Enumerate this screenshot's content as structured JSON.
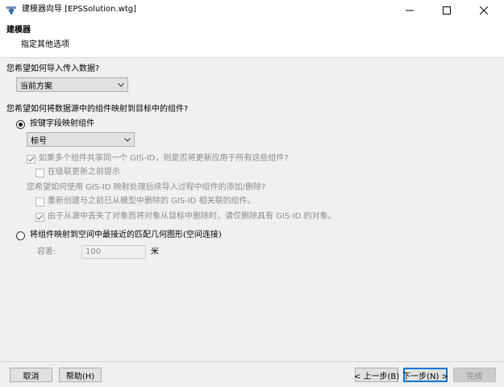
{
  "window": {
    "title": "建模器向导 [EPSSolution.wtg]",
    "app_icon": "modeler-icon",
    "controls": {
      "minimize": "minimize-icon",
      "maximize": "maximize-icon",
      "close": "close-icon"
    }
  },
  "header": {
    "title": "建模器",
    "subtitle": "指定其他选项"
  },
  "import_section": {
    "question": "您希望如何导入传入数据?",
    "combo_value": "当前方案"
  },
  "mapping_section": {
    "question": "您希望如何将数据源中的组件映射到目标中的组件?",
    "radio_key_label": "按键字段映射组件",
    "key_field_value": "标号",
    "share_gisid_label": "如果多个组件共享同一个 GIS-ID，则是否将更新应用于所有这些组件?",
    "cascade_prompt_label": "在级联更新之前提示",
    "gisid_question": "您希望如何使用 GIS-ID 映射处理后续导入过程中组件的添加/删除?",
    "recreate_label": "重新创建与之前已从模型中删除的 GIS-ID 相关联的组件。",
    "delete_missing_label": "由于从源中丢失了对象而将对象从目标中删除时，请仅删除具有 GIS-ID 的对象。",
    "radio_spatial_label": "将组件映射到空间中最接近的匹配几何图形(空间连接)",
    "tolerance_label": "容差:",
    "tolerance_value": "100",
    "tolerance_unit": "米"
  },
  "footer": {
    "cancel": "取消",
    "help": "帮助(H)",
    "back": "< 上一步(B)",
    "next": "下一步(N) >",
    "finish": "完成"
  },
  "colors": {
    "accent": "#0078d7",
    "disabled_text": "#8c8c8c"
  }
}
